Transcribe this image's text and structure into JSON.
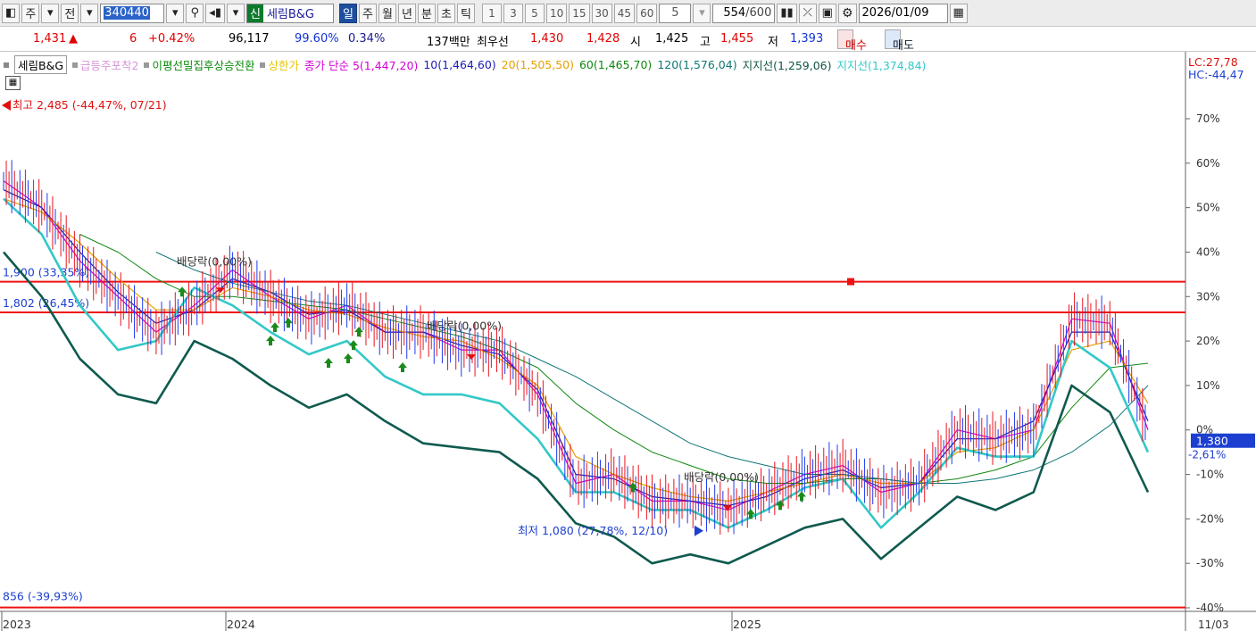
{
  "toolbar": {
    "type_label": "주",
    "prev_label": "전",
    "stock_code": "340440",
    "badge": "신",
    "stock_name": "세림B&G",
    "periods": [
      "일",
      "주",
      "월",
      "년",
      "분",
      "초",
      "틱"
    ],
    "active_period": "일",
    "intervals": [
      "1",
      "3",
      "5",
      "10",
      "15",
      "30",
      "45",
      "60"
    ],
    "interval_value": "5",
    "count": "554",
    "count_total": "/600",
    "date": "2026/01/09"
  },
  "quote": {
    "price": "1,431",
    "arrow": "▲",
    "change": "6",
    "change_pct": "+0.42%",
    "volume": "96,117",
    "vol_ratio": "99.60%",
    "turnover": "0.34%",
    "amount": "137백만",
    "best_label": "최우선",
    "best_ask": "1,430",
    "best_bid": "1,428",
    "open_label": "시",
    "open": "1,425",
    "high_label": "고",
    "high": "1,455",
    "low_label": "저",
    "low": "1,393",
    "buy_label": "매수",
    "sell_label": "매도"
  },
  "legend": {
    "name": "세림B&G",
    "items": [
      {
        "text": "급등주포착2",
        "color": "#d596d8"
      },
      {
        "text": "이평선밀집후상승전환",
        "color": "#0c8a0c"
      },
      {
        "text": "상한가",
        "color": "#e5c400"
      },
      {
        "text": "종가 단순 5(1,447,20)",
        "color": "#d400d4"
      },
      {
        "text": "10(1,464,60)",
        "color": "#1c1cb4"
      },
      {
        "text": "20(1,505,50)",
        "color": "#e5a000"
      },
      {
        "text": "60(1,465,70)",
        "color": "#118811"
      },
      {
        "text": "120(1,576,04)",
        "color": "#117777"
      },
      {
        "text": "지지선(1,259,06)",
        "color": "#115544"
      },
      {
        "text": "지지선(1,374,84)",
        "color": "#33c8c8"
      }
    ]
  },
  "annotations": {
    "high": "최고 2,485 (-44,47%, 07/21)",
    "low": "최저 1,080 (27,78%, 12/10)",
    "level1": "1,900 (33,35%)",
    "level2": "1,802 (26,45%)",
    "level3": "856 (-39,93%)",
    "div1": "배당락(0,00%)",
    "div2": "배당락(0,00%)",
    "div3": "배당락(0,00%)"
  },
  "right_axis": {
    "lc": "LC:27,78",
    "hc": "HC:-44,47",
    "current": "1,380",
    "current_pct": "-2,61%",
    "ticks": [
      "70%",
      "60%",
      "50%",
      "40%",
      "30%",
      "20%",
      "10%",
      "0%",
      "-10%",
      "-20%",
      "-30%",
      "-40%"
    ],
    "bottom_date": "11/03"
  },
  "x_labels": [
    "2023",
    "2024",
    "2025"
  ],
  "colors": {
    "up": "#e8141e",
    "down": "#1e3cf0",
    "ma5": "#d400d4",
    "ma10": "#1c1cb4",
    "ma20": "#e5a000",
    "ma60": "#118811",
    "ma120": "#117777",
    "support1": "#0f5a4e",
    "support2": "#33c8c8",
    "hline": "#ee1111"
  },
  "chart_data": {
    "type": "line",
    "y_unit": "% vs reference price",
    "ylim": [
      -42,
      78
    ],
    "y_ticks": [
      70,
      60,
      50,
      40,
      30,
      20,
      10,
      0,
      -10,
      -20,
      -30,
      -40
    ],
    "x": [
      "2023-07",
      "2023-08",
      "2023-09",
      "2023-10",
      "2023-11",
      "2023-12",
      "2024-01",
      "2024-02",
      "2024-03",
      "2024-04",
      "2024-05",
      "2024-06",
      "2024-07",
      "2024-08",
      "2024-09",
      "2024-10",
      "2024-11",
      "2024-12",
      "2025-01",
      "2025-02",
      "2025-03",
      "2025-04",
      "2025-05",
      "2025-06",
      "2025-07",
      "2025-08",
      "2025-09",
      "2025-10",
      "2025-11",
      "2025-12",
      "2026-01"
    ],
    "series": [
      {
        "name": "5",
        "values": [
          56,
          50,
          38,
          30,
          22,
          28,
          36,
          30,
          25,
          28,
          22,
          22,
          18,
          18,
          8,
          -12,
          -10,
          -16,
          -16,
          -18,
          -14,
          -10,
          -8,
          -14,
          -12,
          0,
          -2,
          0,
          25,
          24,
          0
        ]
      },
      {
        "name": "10",
        "values": [
          54,
          50,
          40,
          31,
          24,
          27,
          34,
          31,
          26,
          27,
          22,
          22,
          19,
          17,
          9,
          -10,
          -11,
          -15,
          -16,
          -17,
          -15,
          -11,
          -9,
          -13,
          -12,
          -2,
          -2,
          2,
          22,
          22,
          2
        ]
      },
      {
        "name": "20",
        "values": [
          52,
          49,
          42,
          34,
          27,
          27,
          32,
          30,
          27,
          26,
          23,
          21,
          20,
          16,
          10,
          -6,
          -10,
          -13,
          -15,
          -16,
          -14,
          -12,
          -10,
          -12,
          -12,
          -5,
          -4,
          0,
          18,
          20,
          6
        ]
      },
      {
        "name": "60",
        "values": [
          null,
          null,
          44,
          40,
          34,
          30,
          30,
          29,
          28,
          27,
          25,
          23,
          21,
          18,
          14,
          6,
          0,
          -5,
          -8,
          -11,
          -12,
          -12,
          -11,
          -11,
          -12,
          -11,
          -9,
          -6,
          5,
          14,
          15
        ]
      },
      {
        "name": "120",
        "values": [
          null,
          null,
          null,
          null,
          40,
          36,
          33,
          31,
          29,
          28,
          26,
          24,
          22,
          20,
          16,
          12,
          7,
          2,
          -3,
          -6,
          -8,
          -10,
          -10,
          -11,
          -12,
          -12,
          -11,
          -9,
          -5,
          1,
          10
        ]
      },
      {
        "name": "지지선(1,259,06)",
        "values": [
          40,
          30,
          16,
          8,
          6,
          20,
          16,
          10,
          5,
          8,
          2,
          -3,
          -4,
          -5,
          -11,
          -21,
          -24,
          -30,
          -28,
          -30,
          -26,
          -22,
          -20,
          -29,
          -22,
          -15,
          -18,
          -14,
          10,
          4,
          -14
        ]
      },
      {
        "name": "지지선(1,374,84)",
        "values": [
          52,
          44,
          28,
          18,
          20,
          32,
          28,
          22,
          17,
          20,
          12,
          8,
          8,
          6,
          -2,
          -14,
          -14,
          -18,
          -18,
          -22,
          -18,
          -13,
          -11,
          -22,
          -14,
          -4,
          -6,
          -6,
          20,
          14,
          -5
        ]
      }
    ],
    "hlines": [
      {
        "label": "1,900 (33,35%)",
        "value": 33.35
      },
      {
        "label": "1,802 (26,45%)",
        "value": 26.45
      },
      {
        "label": "856 (-39,93%)",
        "value": -39.93
      }
    ],
    "high_point": {
      "label": "최고 2,485 (-44,47%, 07/21)"
    },
    "low_point": {
      "label": "최저 1,080 (27,78%, 12/10)"
    },
    "last": {
      "value": -2.61,
      "price": "1,380"
    }
  }
}
